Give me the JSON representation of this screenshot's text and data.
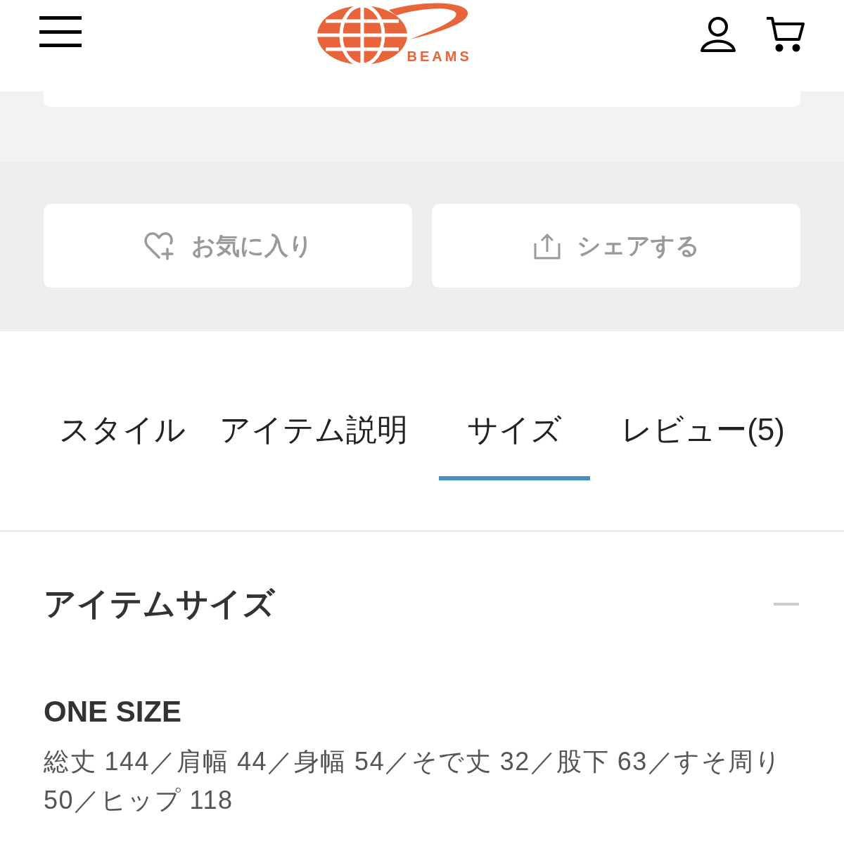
{
  "header": {
    "logo_text": "BEAMS"
  },
  "actions": [
    {
      "kind": "favorite",
      "label": "お気に入り"
    },
    {
      "kind": "share",
      "label": "シェアする"
    }
  ],
  "tabs": [
    {
      "label": "スタイル",
      "selected": false
    },
    {
      "label": "アイテム説明",
      "selected": false
    },
    {
      "label": "サイズ",
      "selected": true
    },
    {
      "label": "レビュー(5)",
      "selected": false
    }
  ],
  "section": {
    "title": "アイテムサイズ",
    "expanded": true,
    "size_name": "ONE SIZE",
    "details": "総丈 144／肩幅 44／身幅 54／そで丈 32／股下 63／すそ周り 50／ヒップ 118"
  }
}
